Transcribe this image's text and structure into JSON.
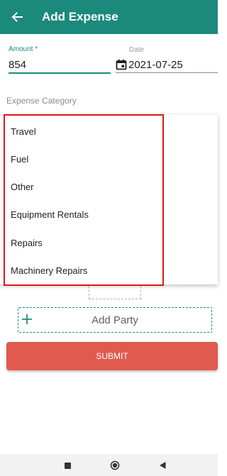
{
  "appbar": {
    "title": "Add Expense",
    "back_icon": "arrow-left-icon",
    "background_color": "#1b8a7c"
  },
  "form": {
    "amount": {
      "label": "Amount *",
      "value": "854"
    },
    "date": {
      "label": "Date",
      "value": "2021-07-25",
      "icon": "calendar-icon"
    },
    "category": {
      "label": "Expense Category"
    }
  },
  "dropdown": {
    "items": [
      {
        "label": "Travel"
      },
      {
        "label": "Fuel"
      },
      {
        "label": "Other"
      },
      {
        "label": "Equipment Rentals"
      },
      {
        "label": "Repairs"
      },
      {
        "label": "Machinery Repairs"
      }
    ],
    "highlight_color": "#e0141b"
  },
  "add_party": {
    "label": "Add Party",
    "icon": "plus-icon"
  },
  "submit": {
    "label": "SUBMIT",
    "color": "#e05a4f"
  },
  "navbar": {
    "icons": [
      "recents-square-icon",
      "home-circle-icon",
      "back-triangle-icon"
    ]
  }
}
